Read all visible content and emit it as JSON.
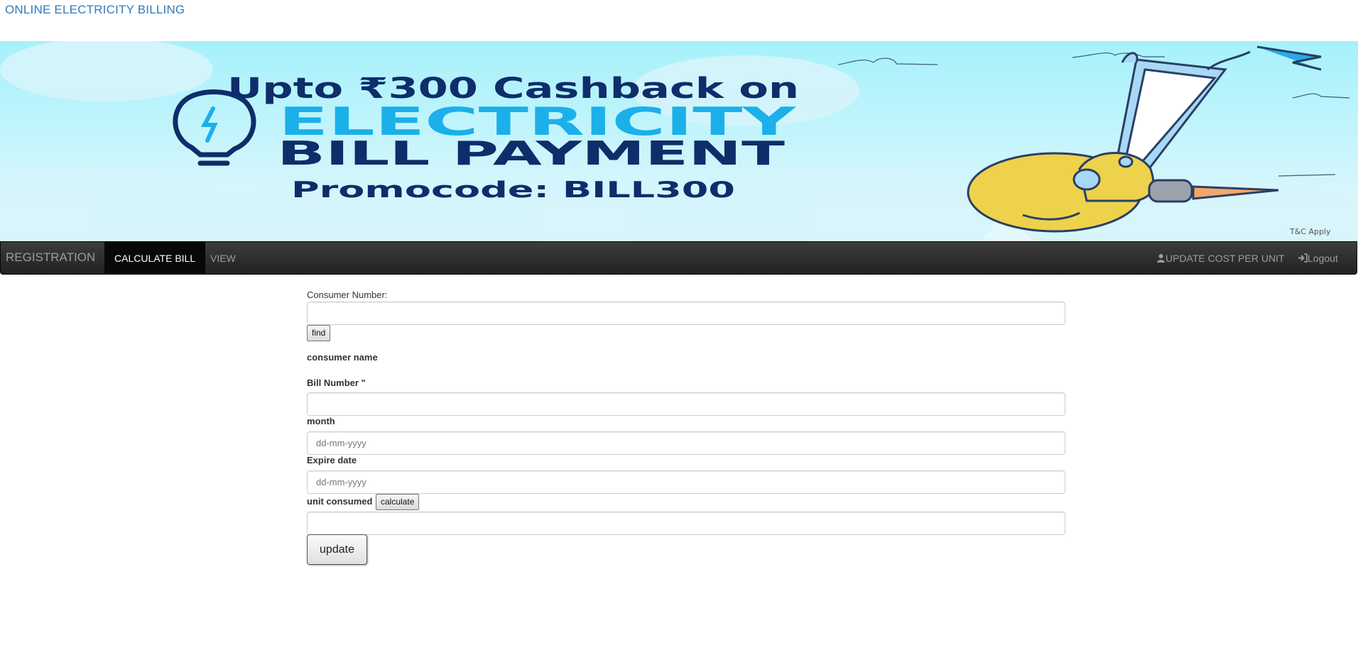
{
  "site": {
    "title": "ONLINE ELECTRICITY BILLING"
  },
  "banner": {
    "headline": "Upto ₹300 Cashback on",
    "big_word": "ELECTRICITY",
    "subline": "BILL PAYMENT",
    "promo": "Promocode: BILL300",
    "tnc": "T&C Apply"
  },
  "navbar": {
    "brand": "REGISTRATION",
    "items": [
      {
        "label": "CALCULATE BILL"
      },
      {
        "label": "VIEW"
      }
    ],
    "right": [
      {
        "label": "UPDATE COST PER UNIT",
        "icon": "user-icon"
      },
      {
        "label": "Logout",
        "icon": "login-icon"
      }
    ]
  },
  "form": {
    "consumer_number_label": "Consumer Number:",
    "consumer_number_value": "",
    "find_label": "find",
    "consumer_name_label": "consumer name",
    "bill_number_label": "Bill Number \"",
    "bill_number_value": "",
    "month_label": "month",
    "month_placeholder": "dd-mm-yyyy",
    "expire_label": "Expire date",
    "expire_placeholder": "dd-mm-yyyy",
    "unit_label": "unit consumed",
    "calculate_label": "calculate",
    "unit_value": "",
    "update_label": "update"
  },
  "colors": {
    "link": "#337ab7",
    "navbar": "#222222",
    "banner_bg": "#bff0fb"
  }
}
